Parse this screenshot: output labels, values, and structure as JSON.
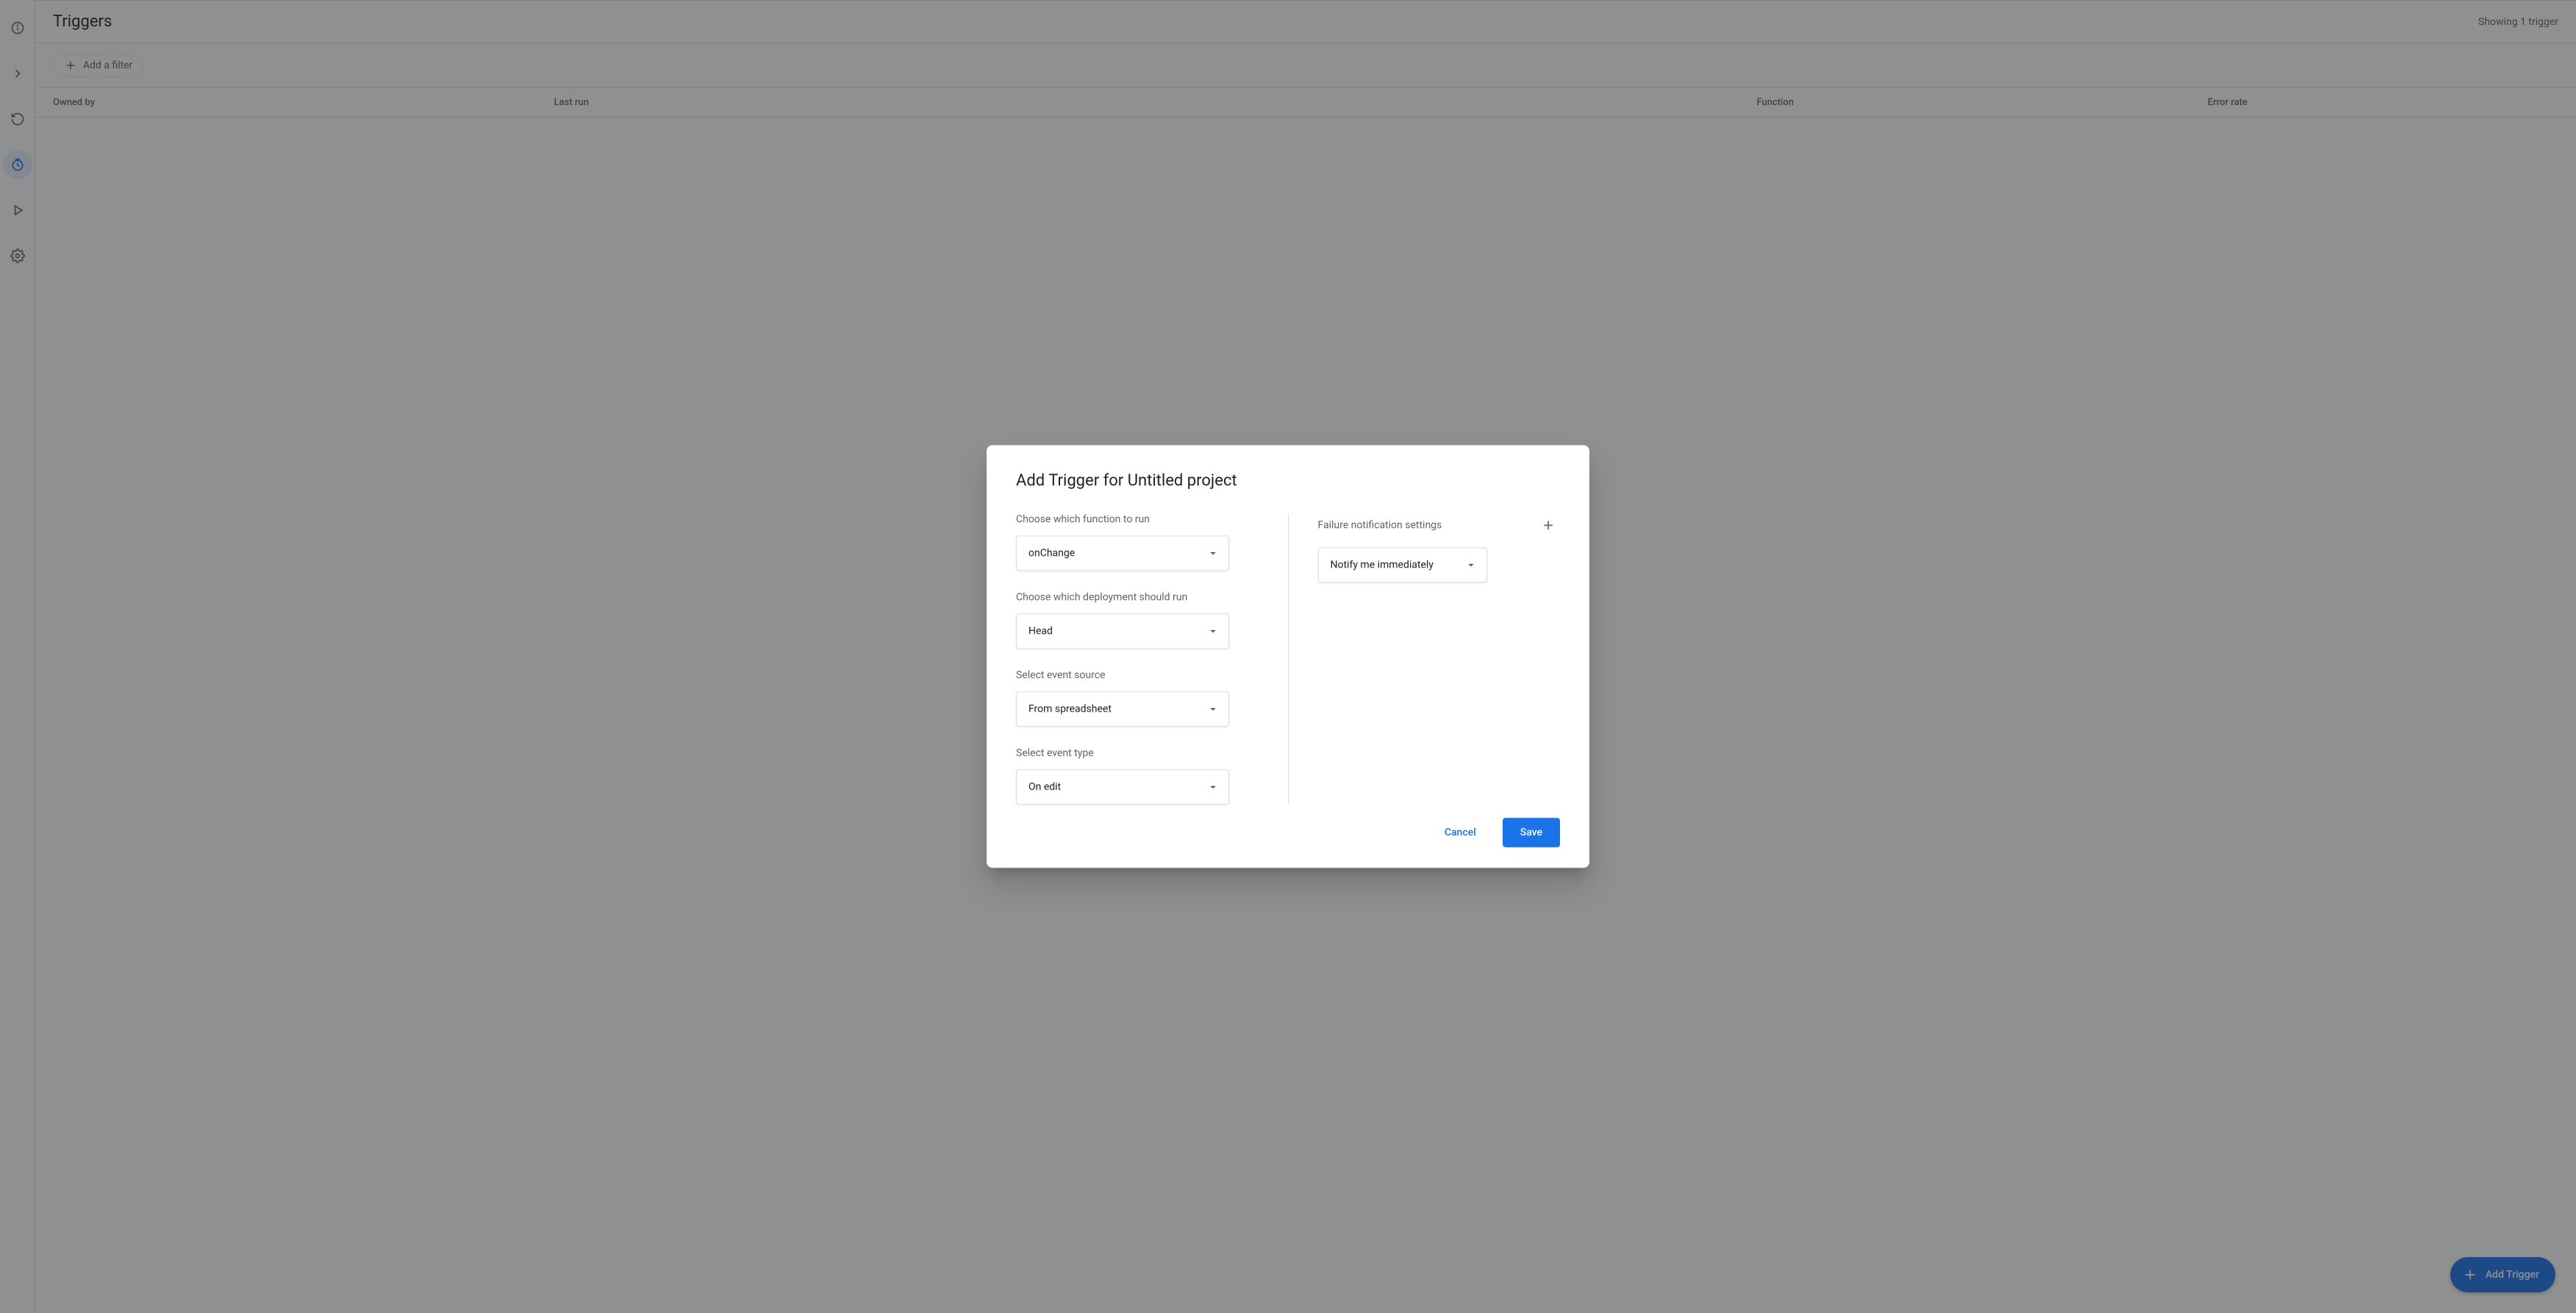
{
  "page": {
    "title": "Triggers",
    "count_text": "Showing 1 trigger",
    "filter_chip": "Add a filter",
    "columns": {
      "owned_by": "Owned by",
      "last_run": "Last run",
      "function": "Function",
      "error_rate": "Error rate"
    },
    "fab_label": "Add Trigger"
  },
  "dialog": {
    "title": "Add Trigger for Untitled project",
    "labels": {
      "function": "Choose which function to run",
      "deployment": "Choose which deployment should run",
      "source": "Select event source",
      "event_type": "Select event type",
      "notification": "Failure notification settings"
    },
    "values": {
      "function": "onChange",
      "deployment": "Head",
      "source": "From spreadsheet",
      "event_type": "On edit",
      "notification": "Notify me immediately"
    },
    "actions": {
      "cancel": "Cancel",
      "save": "Save"
    }
  }
}
